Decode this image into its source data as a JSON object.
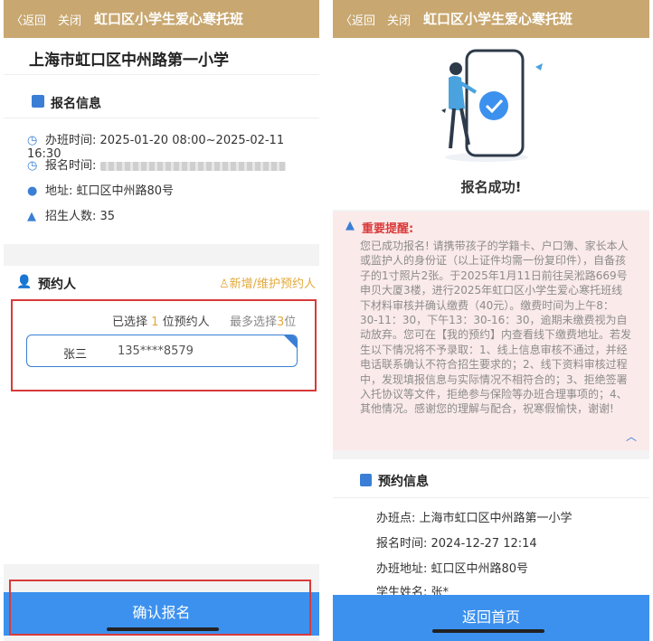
{
  "topbar": {
    "back_label": "〈返回",
    "close_label": "关闭",
    "title": "虹口区小学生爱心寒托班"
  },
  "left": {
    "school_name": "上海市虹口区中州路第一小学",
    "section_signup": "报名信息",
    "rows": [
      {
        "icon": "clock-icon",
        "text": "办班时间: 2025-01-20 08:00~2025-02-11 16:30"
      },
      {
        "icon": "clock-icon",
        "text": "报名时间:"
      },
      {
        "icon": "location-pin-icon",
        "text": "地址: 虹口区中州路80号"
      },
      {
        "icon": "warning-icon",
        "text": "招生人数: 35"
      }
    ],
    "section_booker": "预约人",
    "add_link": "新增/维护预约人",
    "selected_prefix": "已选择",
    "selected_count": "1",
    "selected_suffix": "位预约人",
    "max_prefix": "最多选择",
    "max_count": "3",
    "max_suffix": "位",
    "person": {
      "name": "张三",
      "phone": "135****8579"
    },
    "confirm_label": "确认报名"
  },
  "right": {
    "success_title": "报名成功!",
    "notice_title": "重要提醒:",
    "notice_body": "您已成功报名! 请携带孩子的学籍卡、户口簿、家长本人或监护人的身份证（以上证件均需一份复印件），自备孩子的1寸照片2张。于2025年1月11日前往吴淞路669号申贝大厦3楼，进行2025年虹口区小学生爱心寒托班线下材料审核并确认缴费（40元）。缴费时间为上午8：30-11：30，下午13：30-16：30，逾期未缴费视为自动放弃。您可在【我的预约】内查看线下缴费地址。若发生以下情况将不予录取：1、线上信息审核不通过，并经电话联系确认不符合招生要求的；2、线下资料审核过程中，发现填报信息与实际情况不相符合的；3、拒绝签署入托协议等文件，拒绝参与保险等办班合理事项的；4、其他情况。感谢您的理解与配合，祝寒假愉快，谢谢!",
    "section_booking": "预约信息",
    "booking_rows": [
      "办班点: 上海市虹口区中州路第一小学",
      "报名时间: 2024-12-27 12:14",
      "办班地址: 虹口区中州路80号",
      "学生姓名: 张*"
    ],
    "home_label": "返回首页"
  },
  "colors": {
    "topbar": "#c8a770",
    "primary": "#3c91ee",
    "accent": "#e3a93a",
    "alert_bg": "#fbeaea",
    "alert_red": "#d93a3a"
  }
}
